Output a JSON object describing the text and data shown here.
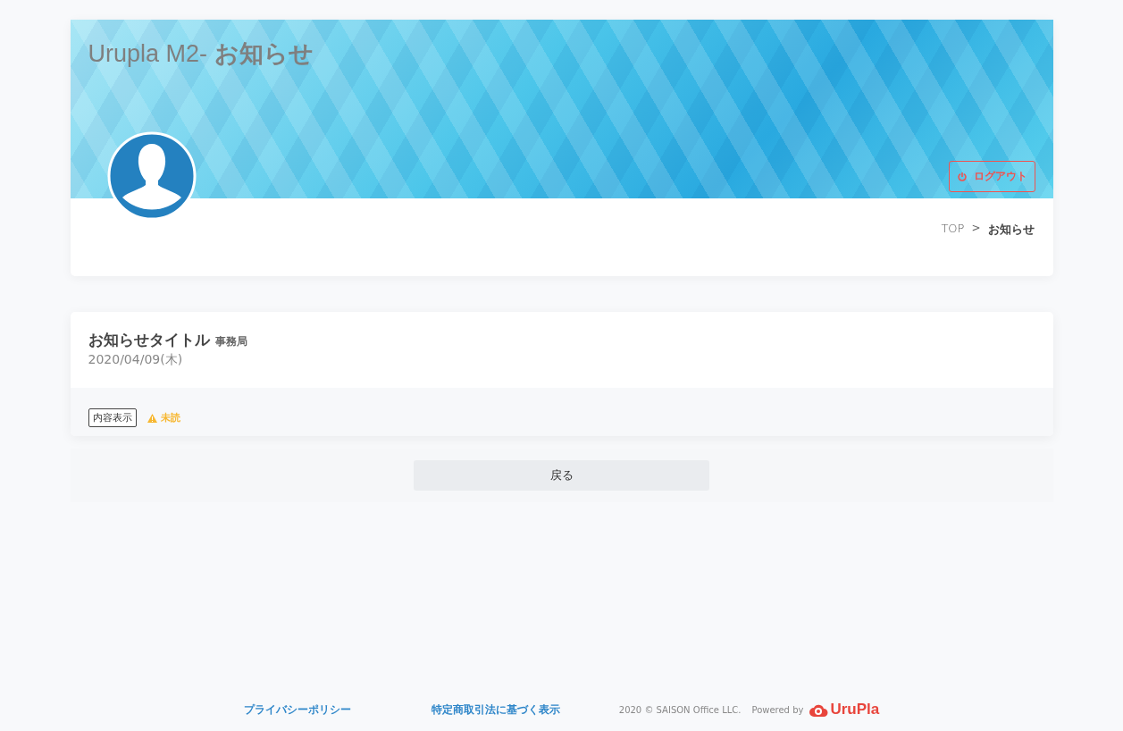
{
  "header": {
    "title_prefix": "Urupla M2-",
    "title_page": "お知らせ",
    "logout": "ログアウト"
  },
  "breadcrumb": [
    {
      "label": "TOP",
      "current": false
    },
    {
      "label": "お知らせ",
      "current": true
    }
  ],
  "breadcrumb_separator": ">",
  "notice": {
    "title": "お知らせタイトル",
    "sender": "事務局",
    "date": "2020/04/09(木)",
    "show_button": "内容表示",
    "status": "未読"
  },
  "back_button": "戻る",
  "footer": {
    "links": [
      "プライバシーポリシー",
      "特定商取引法に基づく表示"
    ],
    "copyright": "2020 © SAISON Office LLC.",
    "powered_by": "Powered by",
    "logo_text": "UruPla"
  }
}
